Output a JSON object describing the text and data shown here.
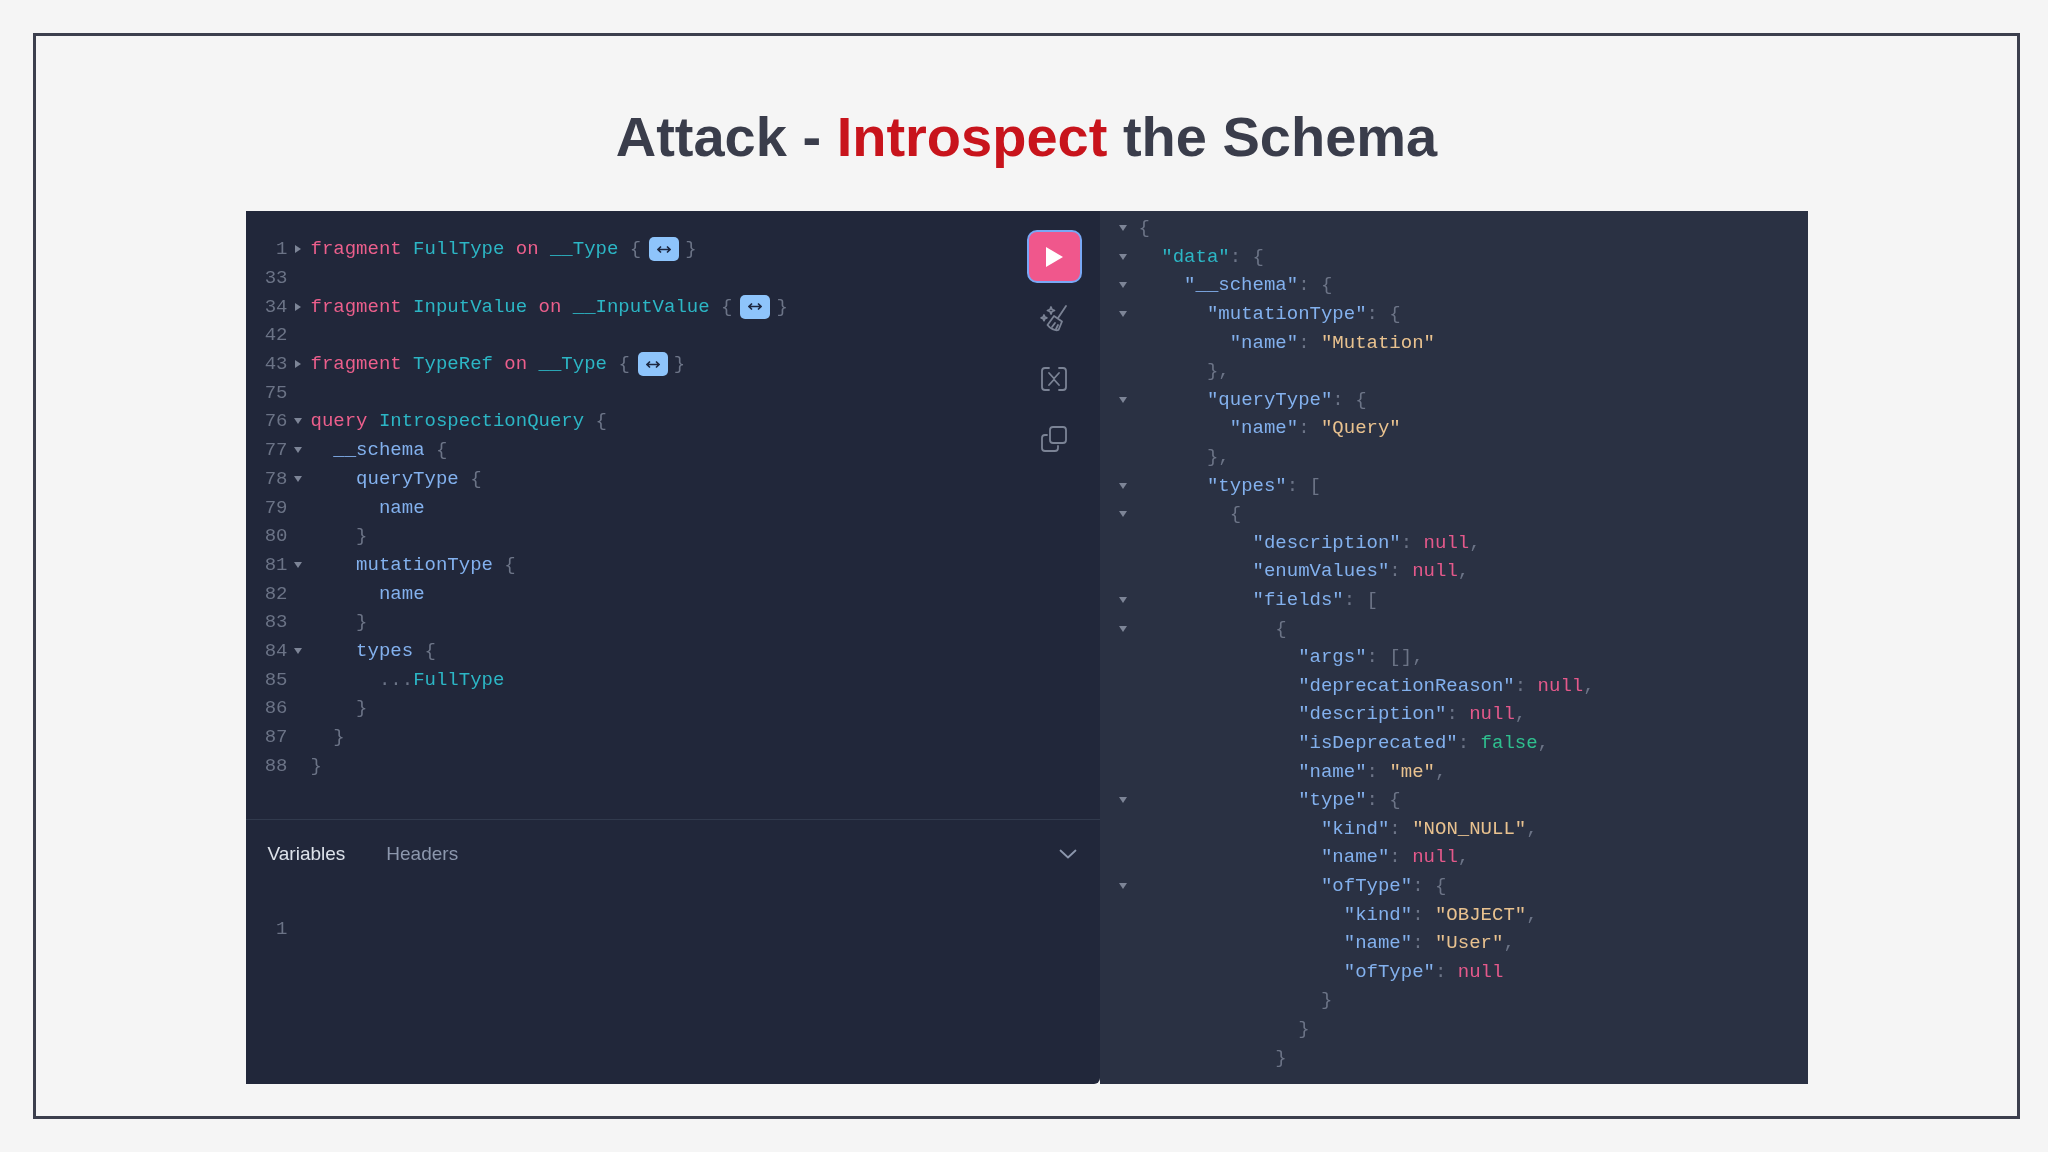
{
  "slide": {
    "title": [
      {
        "text": "Attack - ",
        "highlight": false
      },
      {
        "text": "Introspect",
        "highlight": true
      },
      {
        "text": " the Schema",
        "highlight": false
      }
    ]
  },
  "query_editor": {
    "lines": [
      {
        "number": "1",
        "expanded": false,
        "tokens": [
          {
            "kind": "keyword",
            "text": "fragment"
          },
          {
            "kind": "type",
            "text": " FullType"
          },
          {
            "kind": "keyword",
            "text": " on"
          },
          {
            "kind": "type",
            "text": " __Type"
          },
          {
            "kind": "punct",
            "text": " {"
          },
          {
            "kind": "fold"
          },
          {
            "kind": "punct",
            "text": "}"
          }
        ]
      },
      {
        "number": "33"
      },
      {
        "number": "34",
        "expanded": false,
        "tokens": [
          {
            "kind": "keyword",
            "text": "fragment"
          },
          {
            "kind": "type",
            "text": " InputValue"
          },
          {
            "kind": "keyword",
            "text": " on"
          },
          {
            "kind": "type",
            "text": " __InputValue"
          },
          {
            "kind": "punct",
            "text": " {"
          },
          {
            "kind": "fold"
          },
          {
            "kind": "punct",
            "text": "}"
          }
        ]
      },
      {
        "number": "42"
      },
      {
        "number": "43",
        "expanded": false,
        "tokens": [
          {
            "kind": "keyword",
            "text": "fragment"
          },
          {
            "kind": "type",
            "text": " TypeRef"
          },
          {
            "kind": "keyword",
            "text": " on"
          },
          {
            "kind": "type",
            "text": " __Type"
          },
          {
            "kind": "punct",
            "text": " {"
          },
          {
            "kind": "fold"
          },
          {
            "kind": "punct",
            "text": "}"
          }
        ]
      },
      {
        "number": "75"
      },
      {
        "number": "76",
        "expanded": true,
        "tokens": [
          {
            "kind": "keyword",
            "text": "query"
          },
          {
            "kind": "type",
            "text": " IntrospectionQuery"
          },
          {
            "kind": "punct",
            "text": " {"
          }
        ]
      },
      {
        "number": "77",
        "expanded": true,
        "tokens": [
          {
            "kind": "field",
            "text": "  __schema"
          },
          {
            "kind": "punct",
            "text": " {"
          }
        ]
      },
      {
        "number": "78",
        "expanded": true,
        "tokens": [
          {
            "kind": "field",
            "text": "    queryType"
          },
          {
            "kind": "punct",
            "text": " {"
          }
        ]
      },
      {
        "number": "79",
        "tokens": [
          {
            "kind": "field",
            "text": "      name"
          }
        ]
      },
      {
        "number": "80",
        "tokens": [
          {
            "kind": "punct",
            "text": "    }"
          }
        ]
      },
      {
        "number": "81",
        "expanded": true,
        "tokens": [
          {
            "kind": "field",
            "text": "    mutationType"
          },
          {
            "kind": "punct",
            "text": " {"
          }
        ]
      },
      {
        "number": "82",
        "tokens": [
          {
            "kind": "field",
            "text": "      name"
          }
        ]
      },
      {
        "number": "83",
        "tokens": [
          {
            "kind": "punct",
            "text": "    }"
          }
        ]
      },
      {
        "number": "84",
        "expanded": true,
        "tokens": [
          {
            "kind": "field",
            "text": "    types"
          },
          {
            "kind": "punct",
            "text": " {"
          }
        ]
      },
      {
        "number": "85",
        "tokens": [
          {
            "kind": "punct",
            "text": "      ..."
          },
          {
            "kind": "type",
            "text": "FullType"
          }
        ]
      },
      {
        "number": "86",
        "tokens": [
          {
            "kind": "punct",
            "text": "    }"
          }
        ]
      },
      {
        "number": "87",
        "tokens": [
          {
            "kind": "punct",
            "text": "  }"
          }
        ]
      },
      {
        "number": "88",
        "tokens": [
          {
            "kind": "punct",
            "text": "}"
          }
        ]
      }
    ]
  },
  "variables_panel": {
    "tabs": [
      {
        "label": "Variables",
        "selected": true
      },
      {
        "label": "Headers",
        "selected": false
      }
    ],
    "lines": [
      {
        "number": "1"
      }
    ]
  },
  "result_viewer": {
    "lines": [
      {
        "expanded": true,
        "tokens": [
          {
            "kind": "punct",
            "text": "{"
          }
        ]
      },
      {
        "expanded": true,
        "tokens": [
          {
            "kind": "root-key",
            "text": "  \"data\""
          },
          {
            "kind": "punct",
            "text": ": {"
          }
        ]
      },
      {
        "expanded": true,
        "tokens": [
          {
            "kind": "key",
            "text": "    \"__schema\""
          },
          {
            "kind": "punct",
            "text": ": {"
          }
        ]
      },
      {
        "expanded": true,
        "tokens": [
          {
            "kind": "key",
            "text": "      \"mutationType\""
          },
          {
            "kind": "punct",
            "text": ": {"
          }
        ]
      },
      {
        "tokens": [
          {
            "kind": "key",
            "text": "        \"name\""
          },
          {
            "kind": "punct",
            "text": ": "
          },
          {
            "kind": "string",
            "text": "\"Mutation\""
          }
        ]
      },
      {
        "tokens": [
          {
            "kind": "punct",
            "text": "      },"
          }
        ]
      },
      {
        "expanded": true,
        "tokens": [
          {
            "kind": "key",
            "text": "      \"queryType\""
          },
          {
            "kind": "punct",
            "text": ": {"
          }
        ]
      },
      {
        "tokens": [
          {
            "kind": "key",
            "text": "        \"name\""
          },
          {
            "kind": "punct",
            "text": ": "
          },
          {
            "kind": "string",
            "text": "\"Query\""
          }
        ]
      },
      {
        "tokens": [
          {
            "kind": "punct",
            "text": "      },"
          }
        ]
      },
      {
        "expanded": true,
        "tokens": [
          {
            "kind": "key",
            "text": "      \"types\""
          },
          {
            "kind": "punct",
            "text": ": ["
          }
        ]
      },
      {
        "expanded": true,
        "tokens": [
          {
            "kind": "punct",
            "text": "        {"
          }
        ]
      },
      {
        "tokens": [
          {
            "kind": "key",
            "text": "          \"description\""
          },
          {
            "kind": "punct",
            "text": ": "
          },
          {
            "kind": "null",
            "text": "null"
          },
          {
            "kind": "punct",
            "text": ","
          }
        ]
      },
      {
        "tokens": [
          {
            "kind": "key",
            "text": "          \"enumValues\""
          },
          {
            "kind": "punct",
            "text": ": "
          },
          {
            "kind": "null",
            "text": "null"
          },
          {
            "kind": "punct",
            "text": ","
          }
        ]
      },
      {
        "expanded": true,
        "tokens": [
          {
            "kind": "key",
            "text": "          \"fields\""
          },
          {
            "kind": "punct",
            "text": ": ["
          }
        ]
      },
      {
        "expanded": true,
        "tokens": [
          {
            "kind": "punct",
            "text": "            {"
          }
        ]
      },
      {
        "tokens": [
          {
            "kind": "key",
            "text": "              \"args\""
          },
          {
            "kind": "punct",
            "text": ": [],"
          }
        ]
      },
      {
        "tokens": [
          {
            "kind": "key",
            "text": "              \"deprecationReason\""
          },
          {
            "kind": "punct",
            "text": ": "
          },
          {
            "kind": "null",
            "text": "null"
          },
          {
            "kind": "punct",
            "text": ","
          }
        ]
      },
      {
        "tokens": [
          {
            "kind": "key",
            "text": "              \"description\""
          },
          {
            "kind": "punct",
            "text": ": "
          },
          {
            "kind": "null",
            "text": "null"
          },
          {
            "kind": "punct",
            "text": ","
          }
        ]
      },
      {
        "tokens": [
          {
            "kind": "key",
            "text": "              \"isDeprecated\""
          },
          {
            "kind": "punct",
            "text": ": "
          },
          {
            "kind": "boolean",
            "text": "false"
          },
          {
            "kind": "punct",
            "text": ","
          }
        ]
      },
      {
        "tokens": [
          {
            "kind": "key",
            "text": "              \"name\""
          },
          {
            "kind": "punct",
            "text": ": "
          },
          {
            "kind": "string",
            "text": "\"me\""
          },
          {
            "kind": "punct",
            "text": ","
          }
        ]
      },
      {
        "expanded": true,
        "tokens": [
          {
            "kind": "key",
            "text": "              \"type\""
          },
          {
            "kind": "punct",
            "text": ": {"
          }
        ]
      },
      {
        "tokens": [
          {
            "kind": "key",
            "text": "                \"kind\""
          },
          {
            "kind": "punct",
            "text": ": "
          },
          {
            "kind": "string",
            "text": "\"NON_NULL\""
          },
          {
            "kind": "punct",
            "text": ","
          }
        ]
      },
      {
        "tokens": [
          {
            "kind": "key",
            "text": "                \"name\""
          },
          {
            "kind": "punct",
            "text": ": "
          },
          {
            "kind": "null",
            "text": "null"
          },
          {
            "kind": "punct",
            "text": ","
          }
        ]
      },
      {
        "expanded": true,
        "tokens": [
          {
            "kind": "key",
            "text": "                \"ofType\""
          },
          {
            "kind": "punct",
            "text": ": {"
          }
        ]
      },
      {
        "tokens": [
          {
            "kind": "key",
            "text": "                  \"kind\""
          },
          {
            "kind": "punct",
            "text": ": "
          },
          {
            "kind": "string",
            "text": "\"OBJECT\""
          },
          {
            "kind": "punct",
            "text": ","
          }
        ]
      },
      {
        "tokens": [
          {
            "kind": "key",
            "text": "                  \"name\""
          },
          {
            "kind": "punct",
            "text": ": "
          },
          {
            "kind": "string",
            "text": "\"User\""
          },
          {
            "kind": "punct",
            "text": ","
          }
        ]
      },
      {
        "tokens": [
          {
            "kind": "key",
            "text": "                  \"ofType\""
          },
          {
            "kind": "punct",
            "text": ": "
          },
          {
            "kind": "null",
            "text": "null"
          }
        ]
      },
      {
        "tokens": [
          {
            "kind": "punct",
            "text": "                }"
          }
        ]
      },
      {
        "tokens": [
          {
            "kind": "punct",
            "text": "              }"
          }
        ]
      },
      {
        "tokens": [
          {
            "kind": "punct",
            "text": "            }"
          }
        ]
      }
    ]
  }
}
